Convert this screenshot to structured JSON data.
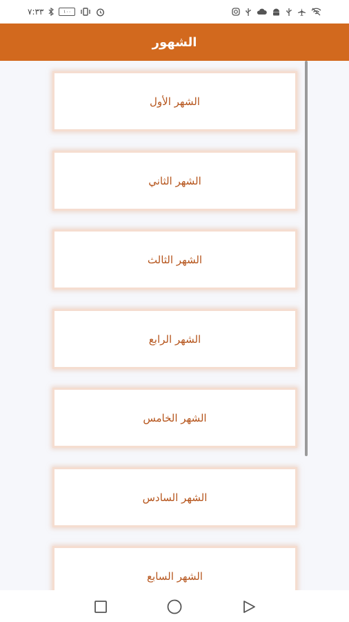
{
  "status_bar": {
    "time": "٧:٣٣",
    "battery": "١٠٠",
    "left_icons": [
      "bluetooth-icon",
      "battery-icon",
      "vibrate-icon",
      "alarm-icon"
    ],
    "right_icons": [
      "instagram-icon",
      "usb-icon",
      "cloud-icon",
      "android-icon",
      "usb-icon",
      "airplane-icon",
      "wifi-off-icon"
    ]
  },
  "app_bar": {
    "title": "الشهور",
    "color": "#d2691e"
  },
  "months": [
    {
      "label": "الشهر الأول"
    },
    {
      "label": "الشهر الثاني"
    },
    {
      "label": "الشهر الثالث"
    },
    {
      "label": "الشهر الرابع"
    },
    {
      "label": "الشهر الخامس"
    },
    {
      "label": "الشهر السادس"
    },
    {
      "label": "الشهر السابع"
    }
  ],
  "nav_bar": {
    "icons": [
      "recent-apps-icon",
      "home-icon",
      "back-icon"
    ]
  },
  "colors": {
    "accent": "#d2691e",
    "label_text": "#b5541b",
    "card_border": "#f5ddd0"
  }
}
